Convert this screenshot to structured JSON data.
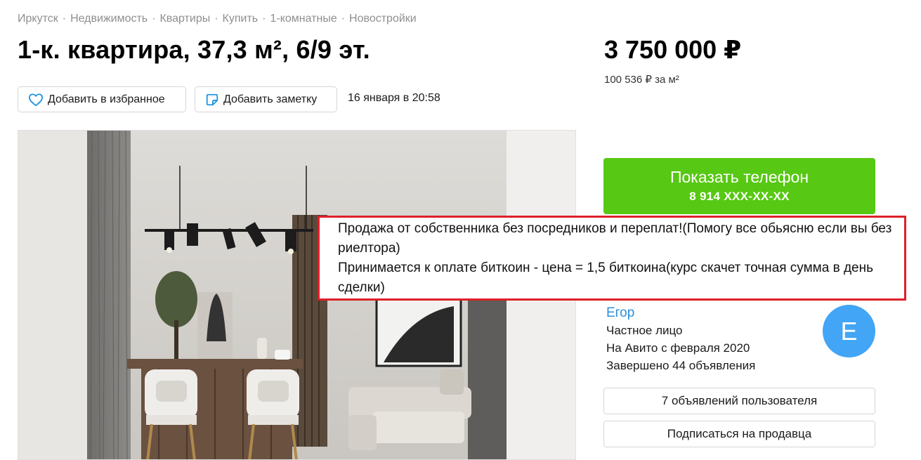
{
  "breadcrumb": [
    "Иркутск",
    "Недвижимость",
    "Квартиры",
    "Купить",
    "1-комнатные",
    "Новостройки"
  ],
  "breadcrumb_separator": "·",
  "listing": {
    "title": "1-к. квартира, 37,3 м², 6/9 эт.",
    "price": "3 750 000 ₽",
    "price_per_m": "100 536 ₽ за м²",
    "date": "16 января в 20:58"
  },
  "actions": {
    "favorite_label": "Добавить в избранное",
    "note_label": "Добавить заметку"
  },
  "phone_button": {
    "label": "Показать телефон",
    "number": "8 914 XXX-XX-XX"
  },
  "description": {
    "line1": "Продажа от собственника без посредников и переплат!(Помогу все обьясню если вы без риелтора)",
    "line2": "Принимается к оплате биткоин - цена = 1,5 биткоина(курс скачет точная сумма в день сделки)"
  },
  "seller": {
    "name": "Егор",
    "type": "Частное лицо",
    "since": "На Авито с февраля 2020",
    "completed": "Завершено 44 объявления",
    "avatar_letter": "Е"
  },
  "seller_actions": {
    "listings_label": "7 объявлений пользователя",
    "subscribe_label": "Подписаться на продавца"
  },
  "icons": {
    "favorite": "heart-icon",
    "note": "note-icon"
  },
  "colors": {
    "accent_green": "#57c813",
    "link_blue": "#2c8fd8",
    "avatar_blue": "#42a5f5",
    "highlight_red": "#de2027"
  }
}
